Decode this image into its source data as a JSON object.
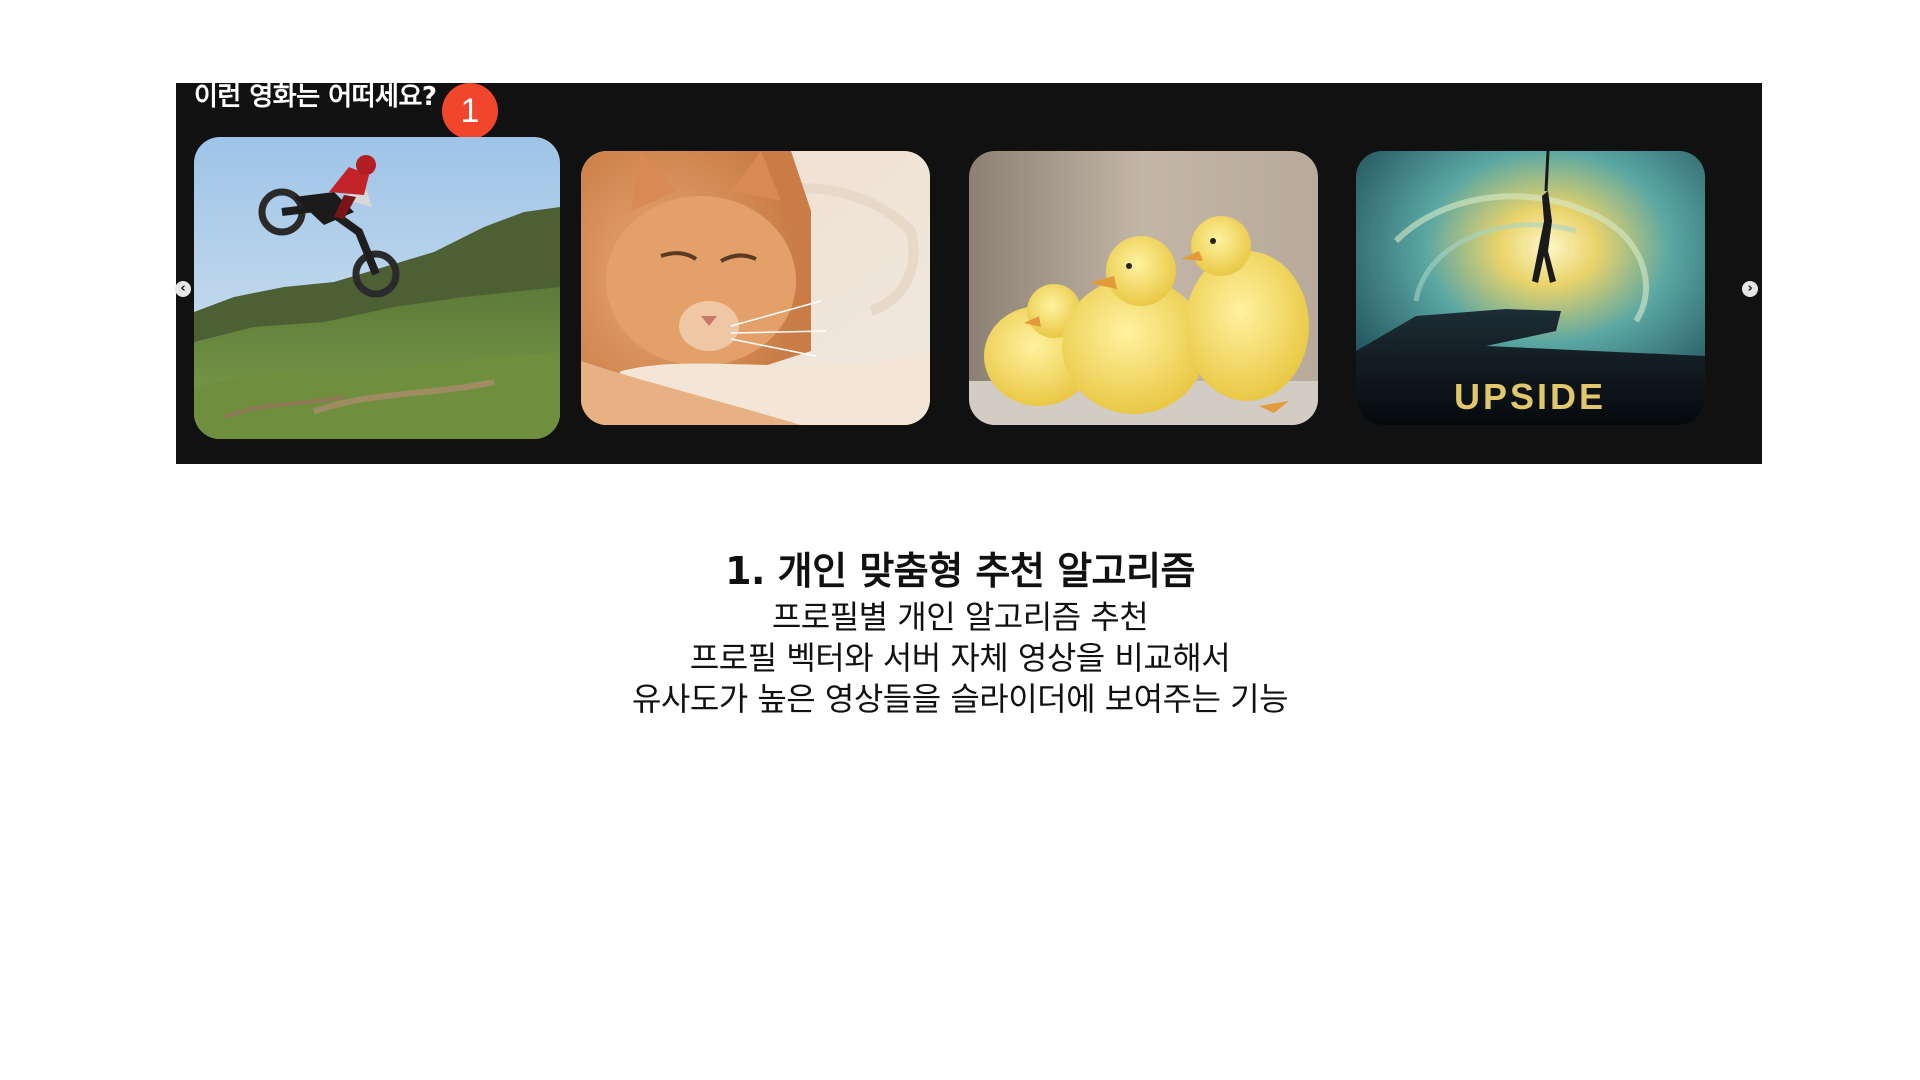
{
  "slider": {
    "title": "이런 영화는 어떠세요?",
    "badge": "1",
    "prev_icon": "chevron-left-icon",
    "next_icon": "chevron-right-icon",
    "prev_glyph": "‹",
    "next_glyph": "›",
    "items": [
      {
        "subject": "motocross-jump",
        "poster_text": ""
      },
      {
        "subject": "orange-cat",
        "poster_text": ""
      },
      {
        "subject": "yellow-ducklings",
        "poster_text": ""
      },
      {
        "subject": "movie-poster",
        "poster_text": "UPSIDE"
      }
    ]
  },
  "description": {
    "heading": "1. 개인 맞춤형 추천 알고리즘",
    "lines": [
      "프로필별 개인 알고리즘 추천",
      "프로필 벡터와 서버 자체 영상을 비교해서",
      "유사도가 높은 영상들을 슬라이더에 보여주는 기능"
    ]
  },
  "colors": {
    "panel_bg": "#121112",
    "badge": "#f1452c",
    "page_bg": "#ffffff"
  }
}
